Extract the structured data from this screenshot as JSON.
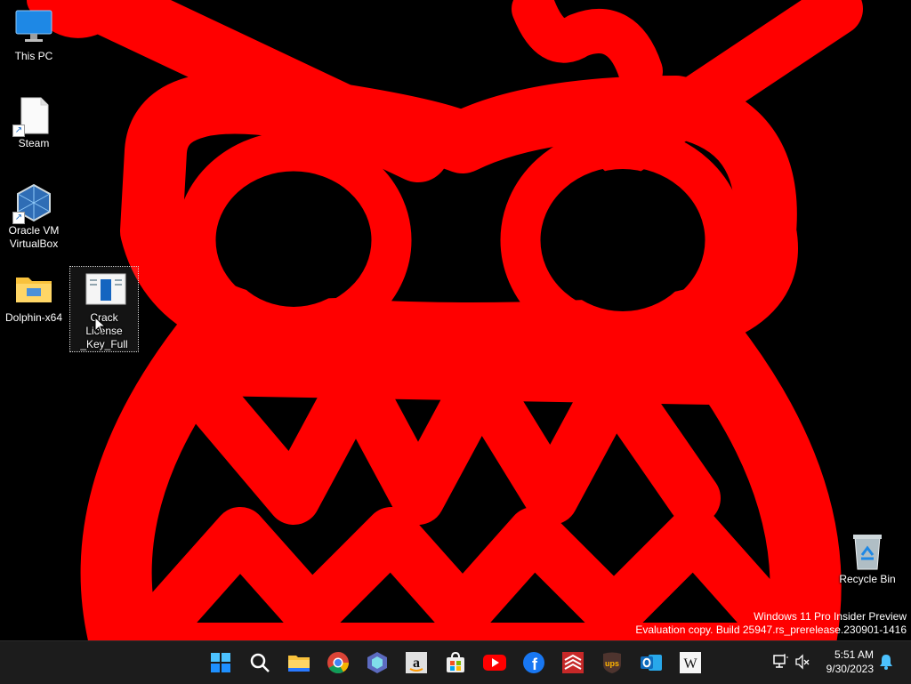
{
  "desktop": {
    "icons": [
      {
        "label": "This PC",
        "icon": "computer-icon"
      },
      {
        "label": "Steam",
        "icon": "blank-file-shortcut-icon"
      },
      {
        "label": "Oracle VM VirtualBox",
        "icon": "virtualbox-icon"
      },
      {
        "label": "Dolphin-x64",
        "icon": "folder-icon"
      },
      {
        "label": "Crack License _Key_Full",
        "icon": "document-icon"
      },
      {
        "label": "Recycle Bin",
        "icon": "recycle-bin-icon"
      }
    ],
    "wallpaper_colors": {
      "background": "#000000",
      "paint": "#ff0000"
    }
  },
  "watermark": {
    "line1": "Windows 11 Pro Insider Preview",
    "line2": "Evaluation copy. Build 25947.rs_prerelease.230901-1416"
  },
  "taskbar": {
    "apps": [
      "start-icon",
      "search-icon",
      "file-explorer-icon",
      "chrome-icon",
      "copilot-icon",
      "amazon-icon",
      "store-icon",
      "youtube-icon",
      "facebook-icon",
      "bank-of-america-icon",
      "ups-icon",
      "outlook-icon",
      "wikipedia-icon"
    ],
    "clock": {
      "time": "5:51 AM",
      "date": "9/30/2023"
    },
    "accent": "#0078d4"
  }
}
